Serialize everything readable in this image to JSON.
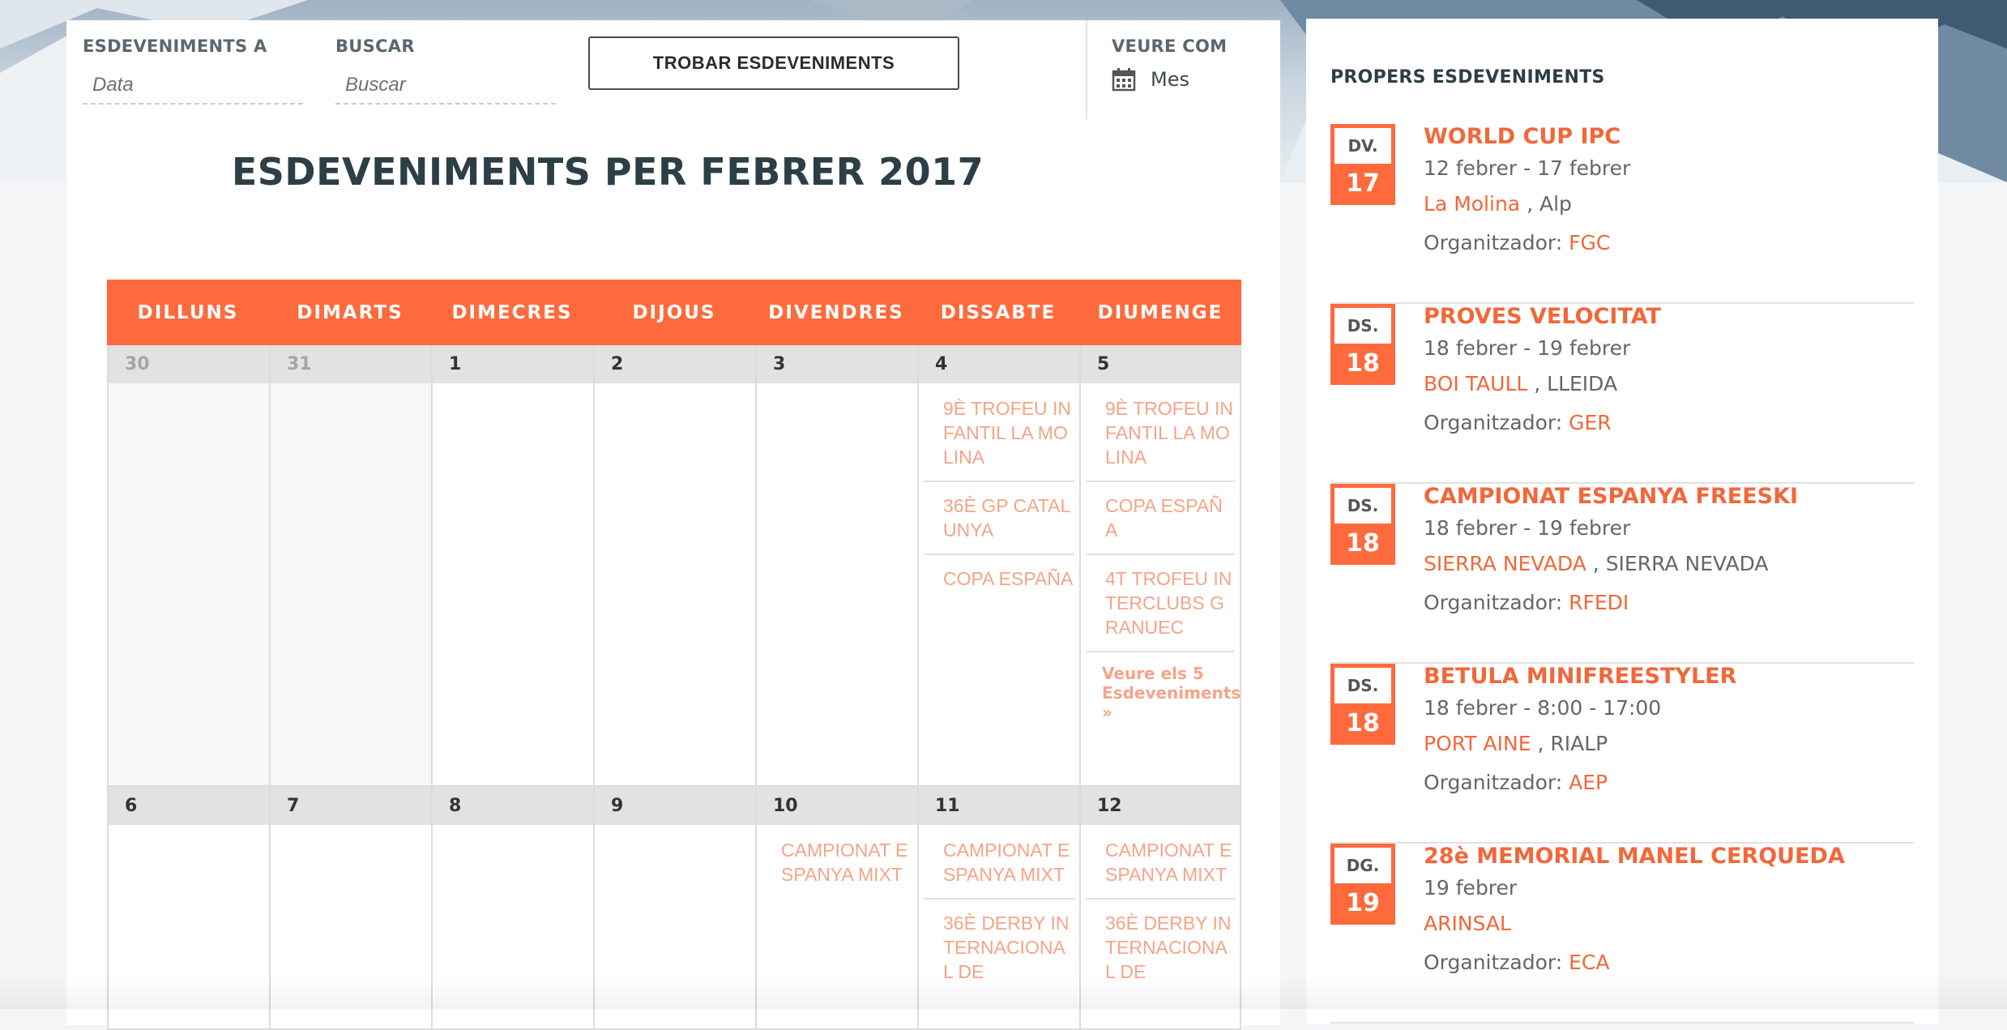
{
  "filters": {
    "date_label": "ESDEVENIMENTS A",
    "date_placeholder": "Data",
    "search_label": "BUSCAR",
    "search_placeholder": "Buscar",
    "find_button": "TROBAR ESDEVENIMENTS",
    "view_label": "VEURE COM",
    "view_value": "Mes"
  },
  "month_title": "ESDEVENIMENTS PER FEBRER 2017",
  "calendar": {
    "weekdays": [
      "DILLUNS",
      "DIMARTS",
      "DIMECRES",
      "DIJOUS",
      "DIVENDRES",
      "DISSABTE",
      "DIUMENGE"
    ],
    "week1": {
      "days": [
        "30",
        "31",
        "1",
        "2",
        "3",
        "4",
        "5"
      ],
      "sat_events": [
        "9è TROFEU INFANTIL LA MOLINA",
        "36è GP CATALUNYA",
        "COPA ESPAÑA"
      ],
      "sun_events": [
        "9è TROFEU INFANTIL LA MOLINA",
        "COPA ESPAÑA",
        "4t TROFEU INTERCLUBS GRANUEC"
      ],
      "sun_more": "Veure els 5 Esdeveniments »"
    },
    "week2": {
      "days": [
        "6",
        "7",
        "8",
        "9",
        "10",
        "11",
        "12"
      ],
      "fri_events": [
        "CAMPIONAT ESPANYA MIXT"
      ],
      "sat_events": [
        "CAMPIONAT ESPANYA MIXT",
        "36è DERBY INTERNACIONAL DE"
      ],
      "sun_events": [
        "CAMPIONAT ESPANYA MIXT",
        "36è DERBY INTERNACIONAL DE"
      ]
    }
  },
  "sidebar": {
    "title": "PROPERS ESDEVENIMENTS",
    "events": [
      {
        "dow": "DV.",
        "day": "17",
        "title": "WORLD CUP IPC",
        "date": "12 febrer - 17 febrer",
        "venue": "La Molina",
        "city": "Alp",
        "org_label": "Organitzador:",
        "org": "FGC"
      },
      {
        "dow": "DS.",
        "day": "18",
        "title": "PROVES VELOCITAT",
        "date": "18 febrer - 19 febrer",
        "venue": "BOI TAULL",
        "city": "LLEIDA",
        "org_label": "Organitzador:",
        "org": "GER"
      },
      {
        "dow": "DS.",
        "day": "18",
        "title": "CAMPIONAT ESPANYA FREESKI",
        "date": "18 febrer - 19 febrer",
        "venue": "SIERRA NEVADA",
        "city": "SIERRA NEVADA",
        "org_label": "Organitzador:",
        "org": "RFEDI"
      },
      {
        "dow": "DS.",
        "day": "18",
        "title": "BETULA MINIFREESTYLER",
        "date": "18 febrer - 8:00 - 17:00",
        "venue": "PORT AINE",
        "city": "RIALP",
        "org_label": "Organitzador:",
        "org": "AEP"
      },
      {
        "dow": "DG.",
        "day": "19",
        "title": "28è MEMORIAL MANEL CERQUEDA",
        "date": "19 febrer",
        "venue": "ARINSAL",
        "city": "",
        "org_label": "Organitzador:",
        "org": "ECA"
      }
    ]
  },
  "colors": {
    "accent": "#ff6a3d",
    "link": "#f2673a",
    "event_text": "#f5a487"
  }
}
